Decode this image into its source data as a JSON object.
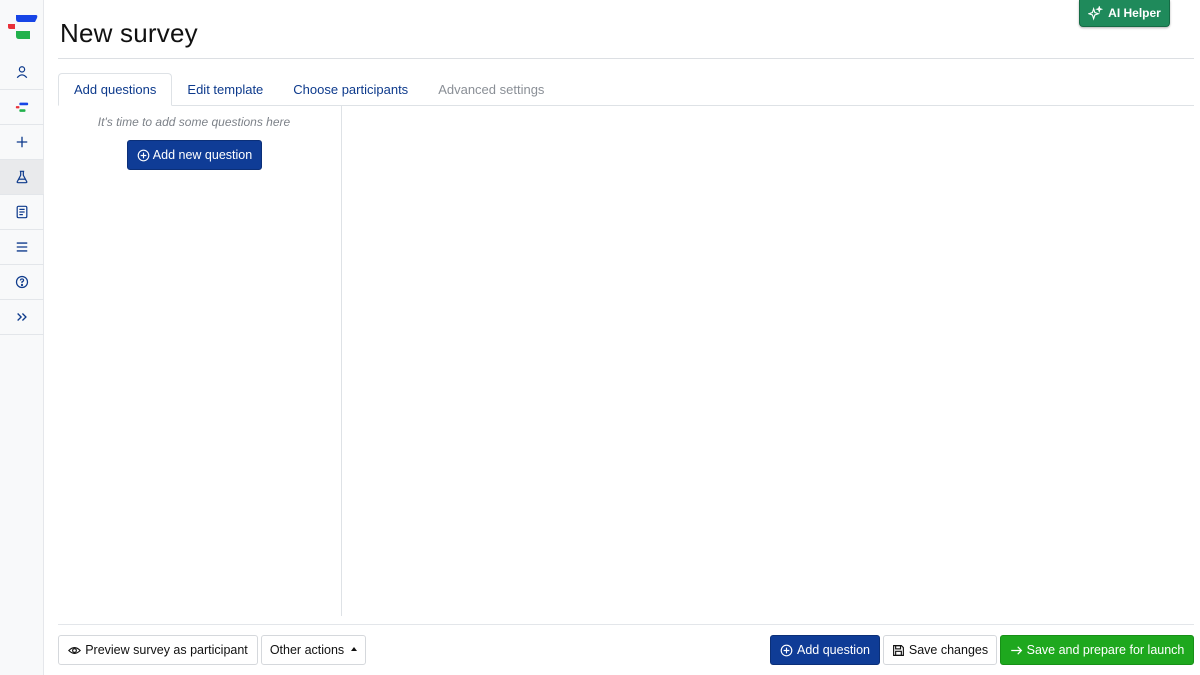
{
  "page": {
    "title": "New survey"
  },
  "ai_helper": {
    "label": "AI Helper",
    "icon": "sparkles-icon",
    "color": "#1f8a5b"
  },
  "sidebar": {
    "items": [
      {
        "name": "user-icon"
      },
      {
        "name": "brand-logo-small-icon"
      },
      {
        "name": "plus-icon"
      },
      {
        "name": "flask-icon"
      },
      {
        "name": "document-list-icon"
      },
      {
        "name": "menu-lines-icon"
      },
      {
        "name": "help-circle-icon"
      },
      {
        "name": "chevrons-right-icon"
      }
    ]
  },
  "tabs": [
    {
      "label": "Add questions",
      "state": "active"
    },
    {
      "label": "Edit template",
      "state": "normal"
    },
    {
      "label": "Choose participants",
      "state": "normal"
    },
    {
      "label": "Advanced settings",
      "state": "disabled"
    }
  ],
  "questions_panel": {
    "empty_hint": "It's time to add some questions here",
    "add_new_label": "Add new question"
  },
  "footer": {
    "preview_label": "Preview survey as participant",
    "other_actions_label": "Other actions",
    "add_question_label": "Add question",
    "save_changes_label": "Save changes",
    "save_launch_label": "Save and prepare for launch"
  },
  "colors": {
    "primary": "#0f3c96",
    "success": "#1ea81e",
    "link": "#0d3a8c"
  }
}
